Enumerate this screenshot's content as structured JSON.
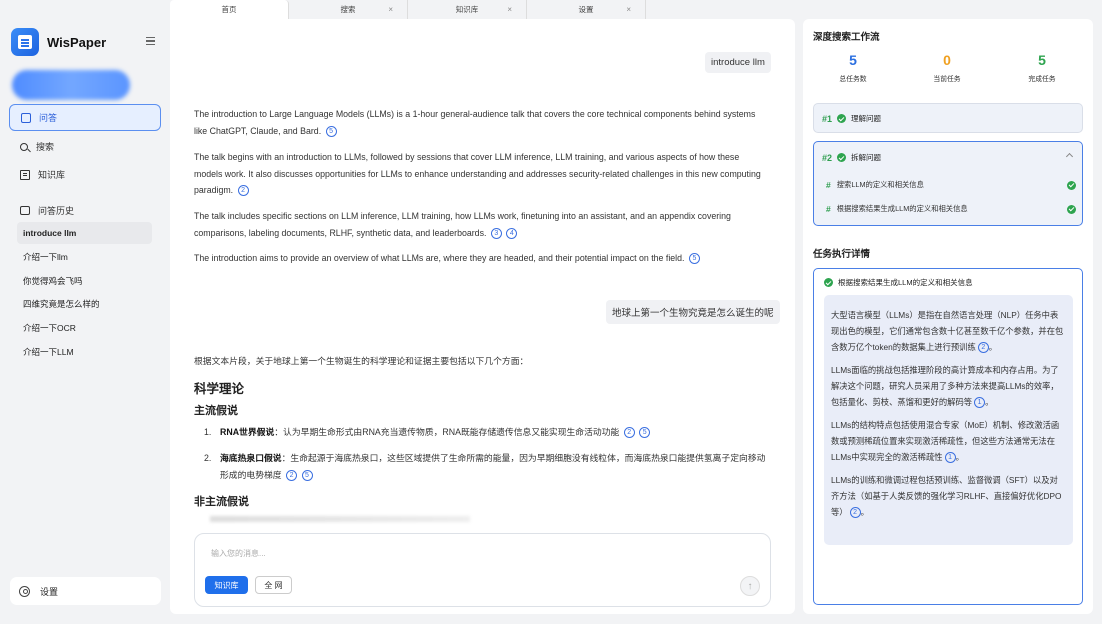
{
  "app": {
    "name": "WisPaper"
  },
  "tabs": [
    {
      "label": "首页",
      "active": true,
      "closable": false
    },
    {
      "label": "搜索",
      "active": false,
      "closable": true
    },
    {
      "label": "知识库",
      "active": false,
      "closable": true
    },
    {
      "label": "设置",
      "active": false,
      "closable": true
    }
  ],
  "tab_close": "×",
  "sidebar": {
    "nav": [
      {
        "label": "问答",
        "icon": "chat-icon"
      },
      {
        "label": "搜索",
        "icon": "search-icon"
      },
      {
        "label": "知识库",
        "icon": "book-icon"
      }
    ],
    "history_title": "问答历史",
    "history": [
      "introduce llm",
      "介绍一下llm",
      "你觉得鸡会飞吗",
      "四维究竟是怎么样的",
      "介绍一下OCR",
      "介绍一下LLM"
    ],
    "settings_label": "设置"
  },
  "chat": {
    "user_msg_1": "introduce llm",
    "answer_1": [
      {
        "text": "The introduction to Large Language Models (LLMs) is a 1-hour general-audience talk that covers the core technical components behind systems like ChatGPT, Claude, and Bard.",
        "cites": [
          "5"
        ]
      },
      {
        "text": "The talk begins with an introduction to LLMs, followed by sessions that cover LLM inference, LLM training, and various aspects of how these models work. It also discusses opportunities for LLMs to enhance understanding and addresses security-related challenges in this new computing paradigm.",
        "cites": [
          "2"
        ]
      },
      {
        "text": "The talk includes specific sections on LLM inference, LLM training, how LLMs work, finetuning into an assistant, and an appendix covering comparisons, labeling documents, RLHF, synthetic data, and leaderboards.",
        "cites": [
          "3",
          "4"
        ]
      },
      {
        "text": "The introduction aims to provide an overview of what LLMs are, where they are headed, and their potential impact on the field.",
        "cites": [
          "5"
        ]
      }
    ],
    "user_msg_2": "地球上第一个生物究竟是怎么诞生的呢",
    "answer_2_intro": "根据文本片段，关于地球上第一个生物诞生的科学理论和证据主要包括以下几个方面：",
    "answer_2_h1": "科学理论",
    "answer_2_h2": "主流假说",
    "answer_2_list": [
      {
        "num": "1.",
        "title": "RNA世界假说",
        "text": "：认为早期生命形式由RNA充当遗传物质，RNA既能存储遗传信息又能实现生命活动功能",
        "cites": [
          "2",
          "5"
        ]
      },
      {
        "num": "2.",
        "title": "海底热泉口假说",
        "text": "：生命起源于海底热泉口，这些区域提供了生命所需的能量，因为早期细胞没有线粒体，而海底热泉口能提供氢离子定向移动形成的电势梯度",
        "cites": [
          "2",
          "5"
        ]
      }
    ],
    "answer_2_h3": "非主流假说",
    "composer": {
      "placeholder": "输入您的消息...",
      "btn_kb": "知识库",
      "btn_web": "全 网",
      "send_icon": "↑"
    }
  },
  "workflow": {
    "title": "深度搜索工作流",
    "stats": [
      {
        "value": "5",
        "label": "总任务数",
        "color": "#2b6fe0"
      },
      {
        "value": "0",
        "label": "当前任务",
        "color": "#f0a020"
      },
      {
        "value": "5",
        "label": "完成任务",
        "color": "#2ea44f"
      }
    ],
    "steps": [
      {
        "num": "#1",
        "label": "理解问题"
      },
      {
        "num": "#2",
        "label": "拆解问题",
        "subs": [
          "搜索LLM的定义和相关信息",
          "根据搜索结果生成LLM的定义和相关信息"
        ]
      }
    ],
    "sub_hash": "#",
    "detail_title": "任务执行详情",
    "detail_task": "根据搜索结果生成LLM的定义和相关信息",
    "detail_paras": [
      {
        "text": "大型语言模型（LLMs）是指在自然语言处理（NLP）任务中表现出色的模型，它们通常包含数十亿甚至数千亿个参数，并在包含数万亿个token的数据集上进行预训练",
        "cites": [
          "2"
        ],
        "end": "。"
      },
      {
        "text": "LLMs面临的挑战包括推理阶段的高计算成本和内存占用。为了解决这个问题，研究人员采用了多种方法来提高LLMs的效率，包括量化、剪枝、蒸馏和更好的解码等",
        "cites": [
          "1"
        ],
        "end": "。"
      },
      {
        "text": "LLMs的结构特点包括使用混合专家（MoE）机制、修改激活函数或预测稀疏位置来实现激活稀疏性，但这些方法通常无法在LLMs中实现完全的激活稀疏性",
        "cites": [
          "1"
        ],
        "end": "。"
      },
      {
        "text": "LLMs的训练和微调过程包括预训练、监督微调（SFT）以及对齐方法（如基于人类反馈的强化学习RLHF、直接偏好优化DPO等）",
        "cites": [
          "2"
        ],
        "end": "。"
      }
    ]
  }
}
